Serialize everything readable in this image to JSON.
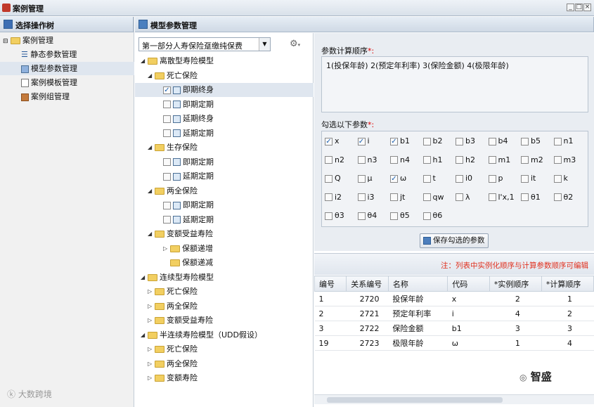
{
  "window": {
    "title": "案例管理",
    "controls": [
      "_",
      "□",
      "×"
    ]
  },
  "left_panel": {
    "header": "选择操作树",
    "items": [
      {
        "label": "案例管理",
        "level": 0
      },
      {
        "label": "静态参数管理",
        "level": 1
      },
      {
        "label": "模型参数管理",
        "level": 1,
        "selected": true
      },
      {
        "label": "案例模板管理",
        "level": 1
      },
      {
        "label": "案例组管理",
        "level": 1
      }
    ]
  },
  "main_panel": {
    "header": "模型参数管理"
  },
  "model_select": {
    "value": "第一部分人寿保险趸缴纯保费"
  },
  "model_tree": [
    {
      "label": "离散型寿险模型",
      "level": 0,
      "type": "folder",
      "open": true
    },
    {
      "label": "死亡保险",
      "level": 1,
      "type": "folder",
      "open": true
    },
    {
      "label": "即期终身",
      "level": 2,
      "type": "form",
      "checked": true,
      "selected": true
    },
    {
      "label": "即期定期",
      "level": 2,
      "type": "form"
    },
    {
      "label": "延期终身",
      "level": 2,
      "type": "form"
    },
    {
      "label": "延期定期",
      "level": 2,
      "type": "form"
    },
    {
      "label": "生存保险",
      "level": 1,
      "type": "folder",
      "open": true
    },
    {
      "label": "即期定期",
      "level": 2,
      "type": "form"
    },
    {
      "label": "延期定期",
      "level": 2,
      "type": "form"
    },
    {
      "label": "两全保险",
      "level": 1,
      "type": "folder",
      "open": true
    },
    {
      "label": "即期定期",
      "level": 2,
      "type": "form"
    },
    {
      "label": "延期定期",
      "level": 2,
      "type": "form"
    },
    {
      "label": "变额受益寿险",
      "level": 1,
      "type": "folder",
      "open": true
    },
    {
      "label": "保额递增",
      "level": 2,
      "type": "folder"
    },
    {
      "label": "保额递减",
      "level": 2,
      "type": "folder",
      "leaf": true
    },
    {
      "label": "连续型寿险模型",
      "level": 0,
      "type": "folder",
      "open": true
    },
    {
      "label": "死亡保险",
      "level": 1,
      "type": "folder"
    },
    {
      "label": "两全保险",
      "level": 1,
      "type": "folder"
    },
    {
      "label": "变额受益寿险",
      "level": 1,
      "type": "folder"
    },
    {
      "label": "半连续寿险模型（UDD假设）",
      "level": 0,
      "type": "folder",
      "open": true
    },
    {
      "label": "死亡保险",
      "level": 1,
      "type": "folder"
    },
    {
      "label": "两全保险",
      "level": 1,
      "type": "folder"
    },
    {
      "label": "变额寿险",
      "level": 1,
      "type": "folder"
    }
  ],
  "param_order": {
    "label": "参数计算顺序",
    "required_mark": "*:",
    "value": "1(投保年龄) 2(预定年利率) 3(保险金额) 4(极限年龄)"
  },
  "param_select": {
    "label": "勾选以下参数",
    "required_mark": "*:",
    "params": [
      {
        "name": "x",
        "checked": true
      },
      {
        "name": "i",
        "checked": true
      },
      {
        "name": "b1",
        "checked": true
      },
      {
        "name": "b2"
      },
      {
        "name": "b3"
      },
      {
        "name": "b4"
      },
      {
        "name": "b5"
      },
      {
        "name": "n1"
      },
      {
        "name": "n2"
      },
      {
        "name": "n3"
      },
      {
        "name": "n4"
      },
      {
        "name": "h1"
      },
      {
        "name": "h2"
      },
      {
        "name": "m1"
      },
      {
        "name": "m2"
      },
      {
        "name": "m3"
      },
      {
        "name": "Q"
      },
      {
        "name": "μ"
      },
      {
        "name": "ω",
        "checked": true
      },
      {
        "name": "t"
      },
      {
        "name": "i0"
      },
      {
        "name": "p"
      },
      {
        "name": "it"
      },
      {
        "name": "k"
      },
      {
        "name": "i2"
      },
      {
        "name": "i3"
      },
      {
        "name": "jt"
      },
      {
        "name": "qw"
      },
      {
        "name": "λ"
      },
      {
        "name": "l'x,1"
      },
      {
        "name": "θ1"
      },
      {
        "name": "θ2"
      },
      {
        "name": "θ3"
      },
      {
        "name": "θ4"
      },
      {
        "name": "θ5"
      },
      {
        "name": "θ6"
      }
    ],
    "save_button": "保存勾选的参数"
  },
  "result_table": {
    "note": "注：列表中实例化顺序与计算参数顺序可编辑",
    "columns": [
      "编号",
      "关系编号",
      "名称",
      "代码",
      "*实例顺序",
      "*计算顺序"
    ],
    "rows": [
      [
        "1",
        "2720",
        "投保年龄",
        "x",
        "2",
        "1"
      ],
      [
        "2",
        "2721",
        "预定年利率",
        "i",
        "4",
        "2"
      ],
      [
        "3",
        "2722",
        "保险金额",
        "b1",
        "3",
        "3"
      ],
      [
        "19",
        "2723",
        "极限年龄",
        "ω",
        "1",
        "4"
      ]
    ]
  },
  "watermarks": {
    "left": "大数跨境",
    "right": "智盛"
  }
}
